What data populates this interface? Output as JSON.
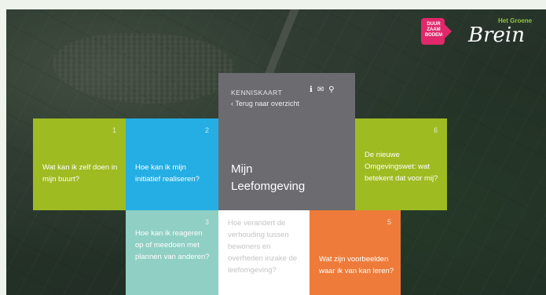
{
  "logos": {
    "dsl_text": "DUUR\nZAAM\nBODEM",
    "brein_small": "Het Groene",
    "brein_big": "Brein"
  },
  "center": {
    "label": "KENNISKAART",
    "back": "Terug naar overzicht",
    "title_line1": "Mijn",
    "title_line2": "Leefomgeving",
    "icons": [
      "info-icon",
      "mail-icon",
      "search-icon"
    ]
  },
  "tiles": [
    {
      "num": "1",
      "text": "Wat kan ik zelf doen in mijn buurt?",
      "color": "#9ebb22"
    },
    {
      "num": "2",
      "text": "Hoe kan ik mijn initiatief realiseren?",
      "color": "#24aee4"
    },
    {
      "num": "3",
      "text": "Hoe kan ik reageren op of meedoen met plannen van anderen?",
      "color": "#8fcfc4"
    },
    {
      "num": "",
      "text": "Hoe verandert de verhouding tussen bewoners en overheden inzake de leefomgeving?",
      "color": "#ffffff"
    },
    {
      "num": "5",
      "text": "Wat zijn voorbeelden waar ik van kan leren?",
      "color": "#ee7b3a"
    },
    {
      "num": "6",
      "text": "De nieuwe Omgevingswet: wat betekent dat voor mij?",
      "color": "#9ebb22"
    }
  ]
}
